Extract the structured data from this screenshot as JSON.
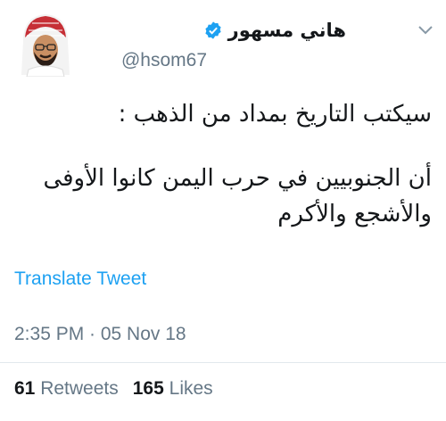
{
  "author": {
    "display_name": "هاني مسهور",
    "handle": "@hsom67",
    "verified_icon": "verified-badge-icon"
  },
  "tweet": {
    "line_1": "سيكتب التاريخ بمداد من الذهب :",
    "line_2": "أن الجنوبيين في حرب اليمن كانوا الأوفى",
    "line_3": "والأشجع والأكرم"
  },
  "actions": {
    "translate_label": "Translate Tweet"
  },
  "meta": {
    "timestamp": "2:35 PM · 05 Nov 18"
  },
  "stats": {
    "retweets_count": "61",
    "retweets_label": "Retweets",
    "likes_count": "165",
    "likes_label": "Likes"
  },
  "colors": {
    "accent": "#1da1f2",
    "secondary_text": "#657786",
    "primary_text": "#14171a"
  }
}
